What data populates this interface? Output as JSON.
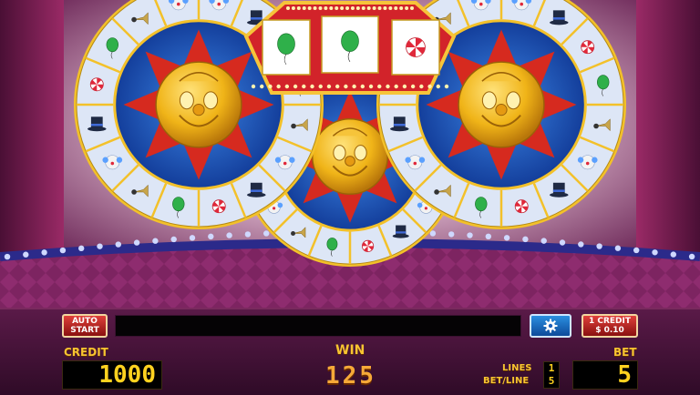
{
  "controls": {
    "auto_start_line1": "AUTO",
    "auto_start_line2": "START",
    "credit_value_line1": "1 CREDIT",
    "credit_value_line2": "$ 0.10",
    "settings_icon": "gear-icon"
  },
  "meters": {
    "credit_label": "CREDIT",
    "credit": "1000",
    "win_label": "WIN",
    "win": "125",
    "bet_label": "BET",
    "bet": "5",
    "lines_label": "LINES",
    "lines": "1",
    "bet_per_line_label": "BET/LINE",
    "bet_per_line": "5"
  },
  "symbols": {
    "center": "clown-coin",
    "marquee": [
      "green-balloon",
      "green-balloon",
      "peppermint-candy"
    ],
    "ring": [
      "clown-face",
      "top-hat",
      "peppermint-candy",
      "green-balloon",
      "horn"
    ]
  },
  "colors": {
    "wheel_blue": "#1f5ec8",
    "wheel_rim": "#f3c12a",
    "star_red": "#d62a1f",
    "coin_gold": "#f0b418",
    "meter_text": "#ffd21f",
    "label_text": "#f7c431",
    "curtain": "#8a1f55"
  }
}
